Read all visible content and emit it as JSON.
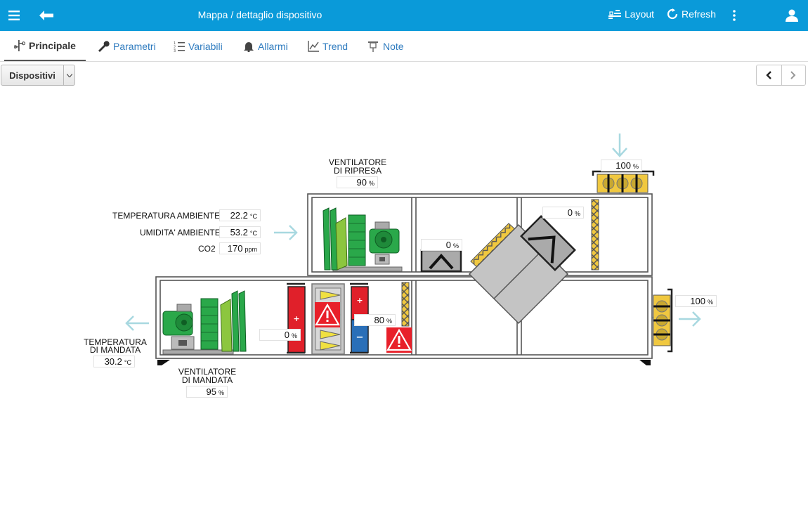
{
  "header": {
    "title": "Mappa / dettaglio dispositivo",
    "layout_label": "Layout",
    "refresh_label": "Refresh"
  },
  "tabs": [
    {
      "label": "Principale",
      "icon": "tree-icon"
    },
    {
      "label": "Parametri",
      "icon": "wrench-icon"
    },
    {
      "label": "Variabili",
      "icon": "list-icon"
    },
    {
      "label": "Allarmi",
      "icon": "bell-icon"
    },
    {
      "label": "Trend",
      "icon": "chart-icon"
    },
    {
      "label": "Note",
      "icon": "pin-icon"
    }
  ],
  "toolbar": {
    "dropdown_label": "Dispositivi"
  },
  "unit": {
    "left_labels": {
      "temp_ambiente": "TEMPERATURA AMBIENTE",
      "umidita_ambiente": "UMIDITA' AMBIENTE",
      "co2": "CO2",
      "temp_mandata_1": "TEMPERATURA",
      "temp_mandata_2": "DI MANDATA",
      "vent_ripresa_1": "VENTILATORE",
      "vent_ripresa_2": "DI RIPRESA",
      "vent_mandata_1": "VENTILATORE",
      "vent_mandata_2": "DI MANDATA"
    },
    "values": {
      "temp_ambiente": {
        "value": "22.2",
        "unit": "°C"
      },
      "umidita_ambiente": {
        "value": "53.2",
        "unit": "°C"
      },
      "co2": {
        "value": "170",
        "unit": "ppm"
      },
      "temp_mandata": {
        "value": "30.2",
        "unit": "°C"
      },
      "vent_ripresa": {
        "value": "90",
        "unit": "%"
      },
      "vent_mandata": {
        "value": "95",
        "unit": "%"
      },
      "damper_top": {
        "value": "100",
        "unit": "%"
      },
      "damper_right": {
        "value": "100",
        "unit": "%"
      },
      "bypass_damper_1": {
        "value": "0",
        "unit": "%"
      },
      "bypass_damper_2": {
        "value": "0",
        "unit": "%"
      },
      "heating_coil": {
        "value": "0",
        "unit": "%"
      },
      "cooling_coil": {
        "value": "80",
        "unit": "%"
      }
    },
    "colors": {
      "header_bg": "#0a9ad9",
      "tab_link": "#2e7bbf",
      "fan_green": "#2aa84a",
      "coil_red": "#e0202a",
      "coil_blue": "#2a6fb8",
      "damper_yellow": "#f0c840",
      "airflow": "#a8d8e0"
    }
  }
}
